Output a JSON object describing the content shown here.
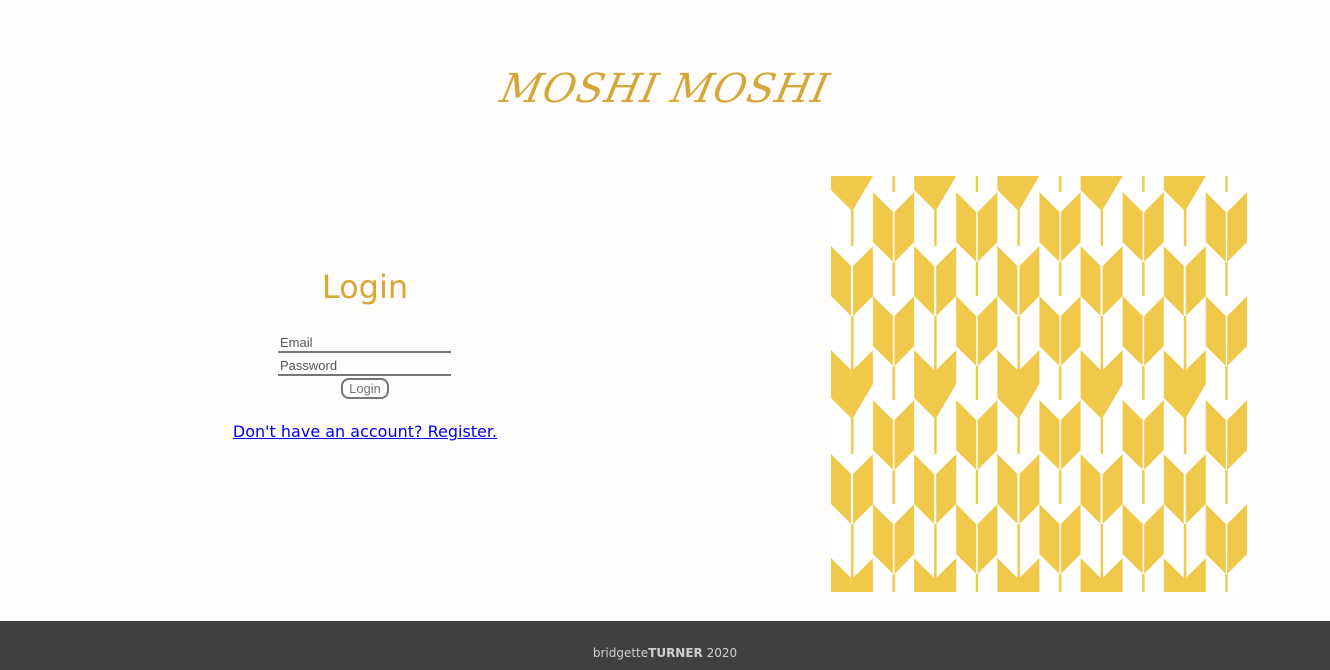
{
  "help": {
    "icon": "question-circle-icon"
  },
  "header": {
    "brand": "MOSHI MOSHI"
  },
  "login": {
    "title": "Login",
    "email_placeholder": "Email",
    "password_placeholder": "Password",
    "button_label": "Login",
    "register_link": "Don't have an account? Register."
  },
  "pattern": {
    "icon": "yagasuri-arrow-pattern",
    "color": "#f0c94a"
  },
  "footer": {
    "first": "bridgette",
    "last": "TURNER",
    "year": " 2020"
  },
  "colors": {
    "accent": "#d9a736",
    "footer_bg": "#404040",
    "link": "#0000ee"
  }
}
